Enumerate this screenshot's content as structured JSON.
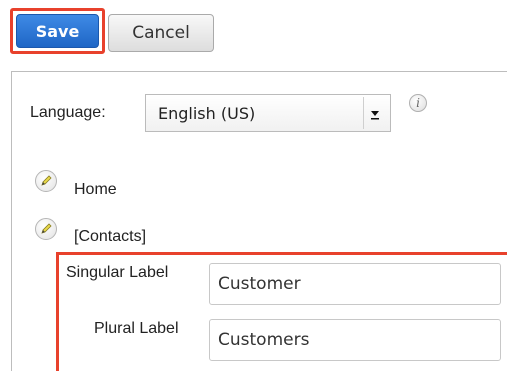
{
  "toolbar": {
    "save_label": "Save",
    "cancel_label": "Cancel"
  },
  "language": {
    "label": "Language:",
    "selected": "English (US)",
    "info_icon": "info-icon"
  },
  "modules": [
    {
      "label": "Home",
      "icon": "pencil-icon"
    },
    {
      "label": "[Contacts]",
      "icon": "pencil-icon"
    }
  ],
  "fields": {
    "singular_label": "Singular Label",
    "singular_value": "Customer",
    "plural_label": "Plural Label",
    "plural_value": "Customers"
  },
  "colors": {
    "highlight": "#e8412c",
    "primary_button": "#2b73d6"
  }
}
